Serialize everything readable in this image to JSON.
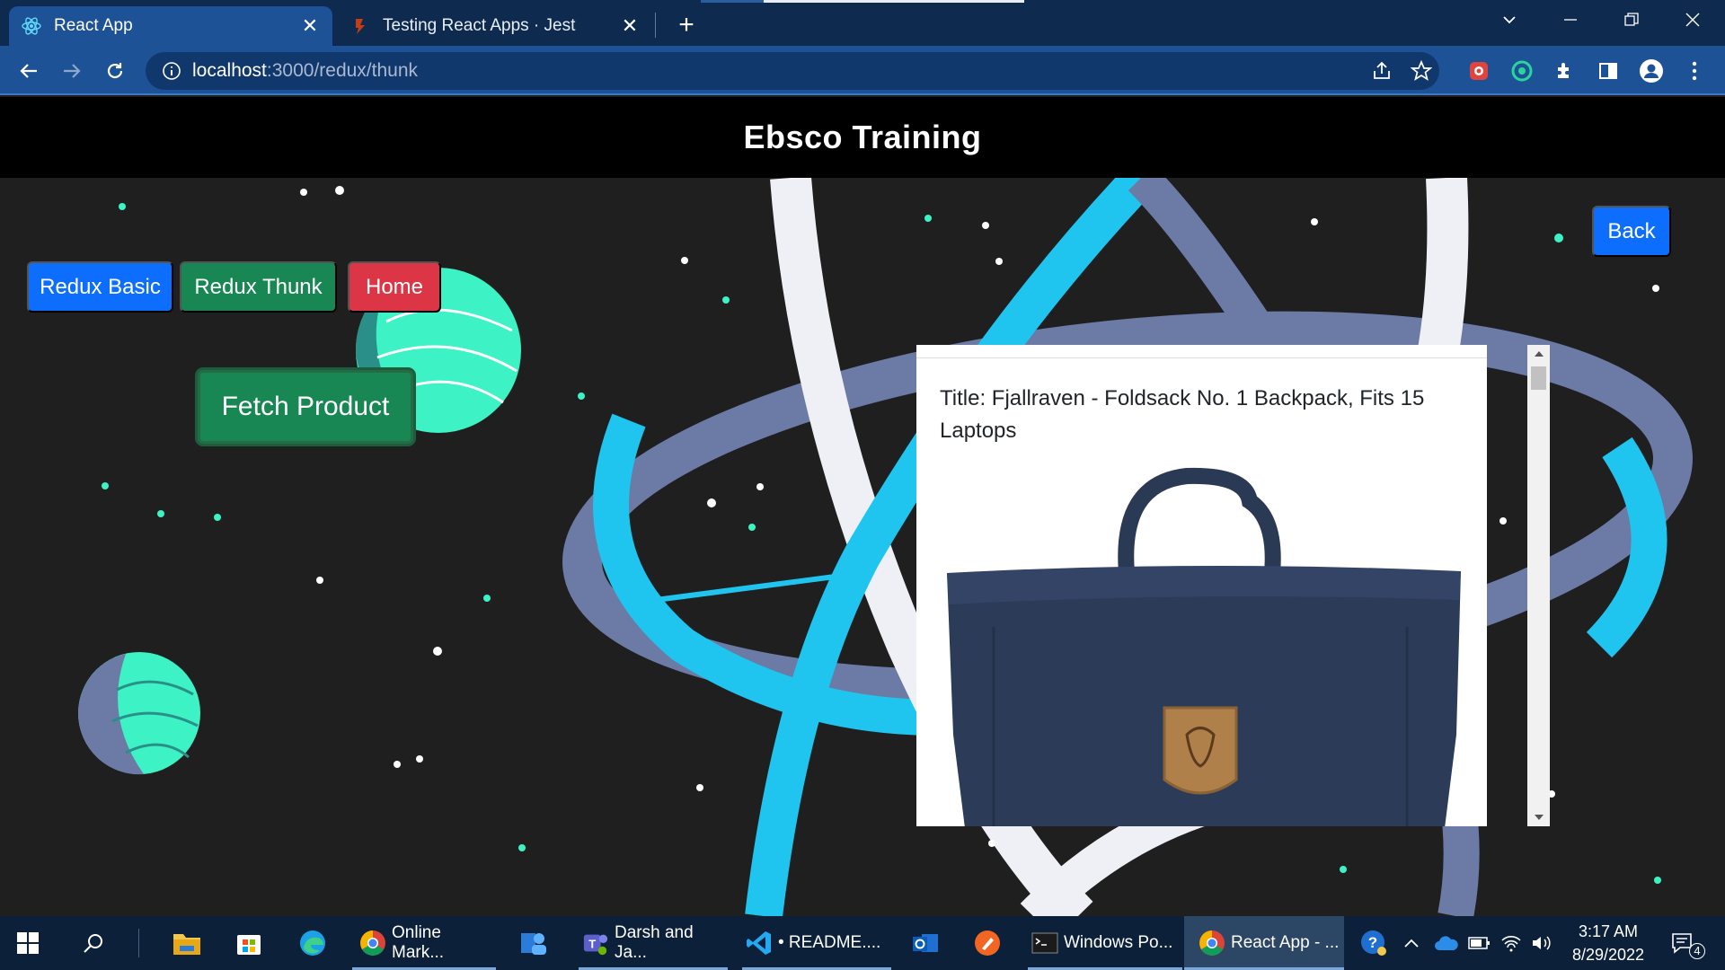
{
  "browser": {
    "tabs": [
      {
        "title": "React App",
        "icon": "react-icon",
        "active": true
      },
      {
        "title": "Testing React Apps · Jest",
        "icon": "jest-icon",
        "active": false
      }
    ],
    "url_host": "localhost",
    "url_path": ":3000/redux/thunk",
    "accent": "#1d5296"
  },
  "app": {
    "header_title": "Ebsco Training",
    "nav": {
      "redux_basic": "Redux Basic",
      "redux_thunk": "Redux Thunk",
      "home": "Home"
    },
    "fetch_button": "Fetch Product",
    "back_button": "Back",
    "product": {
      "title": "Title: Fjallraven - Foldsack No. 1 Backpack, Fits 15 Laptops"
    },
    "colors": {
      "primary": "#0d6efd",
      "success": "#198754",
      "danger": "#dc3545"
    }
  },
  "taskbar": {
    "apps": [
      {
        "label": "Online Mark...",
        "icon": "chrome-icon"
      },
      {
        "label": "Darsh and Ja...",
        "icon": "teams-icon"
      },
      {
        "label": "• README....",
        "icon": "vscode-icon"
      },
      {
        "label": "Windows Po...",
        "icon": "terminal-icon"
      },
      {
        "label": "React App - ...",
        "icon": "chrome-icon"
      }
    ],
    "time": "3:17 AM",
    "date": "8/29/2022",
    "notification_count": "4"
  }
}
